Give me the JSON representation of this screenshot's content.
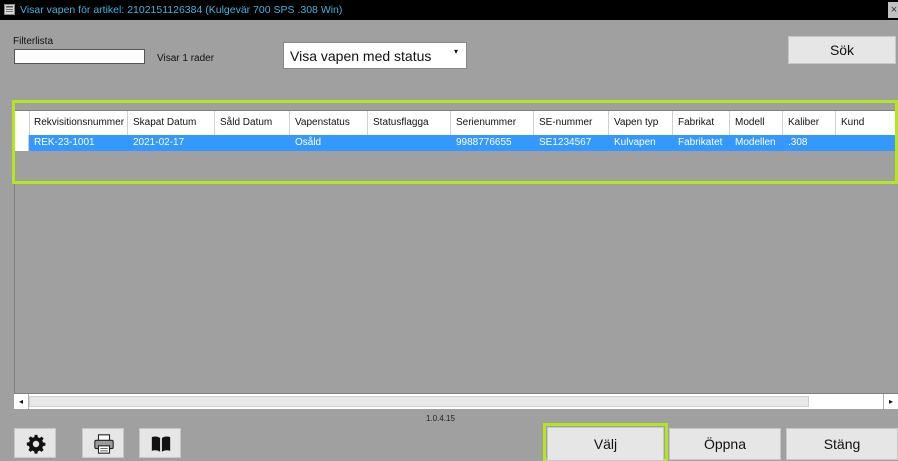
{
  "window": {
    "title": "Visar vapen för artikel: 2102151126384 (Kulgevär 700 SPS .308 Win)",
    "close_label": "×"
  },
  "filter": {
    "label": "Filterlista",
    "value": "",
    "rows_text": "Visar 1 rader"
  },
  "status_select": {
    "selected": "Visa vapen med status",
    "arrow": "▾"
  },
  "search_button": "Sök",
  "grid": {
    "columns": [
      "Rekvisitionsnummer",
      "Skapat Datum",
      "Såld Datum",
      "Vapenstatus",
      "Statusflagga",
      "Serienummer",
      "SE-nummer",
      "Vapen typ",
      "Fabrikat",
      "Modell",
      "Kaliber",
      "Kund"
    ],
    "rows": [
      [
        "REK-23-1001",
        "2021-02-17",
        "",
        "Osåld",
        "",
        "9988776655",
        "SE1234567",
        "Kulvapen",
        "Fabrikatet",
        "Modellen",
        ".308",
        ""
      ]
    ]
  },
  "scrollbar": {
    "left_arrow": "◂",
    "right_arrow": "▸"
  },
  "version": "1.0.4.15",
  "toolbar": {
    "settings_icon": "gear-icon",
    "print_icon": "printer-icon",
    "manual_icon": "book-icon"
  },
  "buttons": {
    "valj": "Välj",
    "oppna": "Öppna",
    "stang": "Stäng"
  },
  "colors": {
    "title_text": "#3fb4e0",
    "selection": "#3399ff",
    "highlight": "#b5e61d",
    "background": "#a0a0a0"
  }
}
